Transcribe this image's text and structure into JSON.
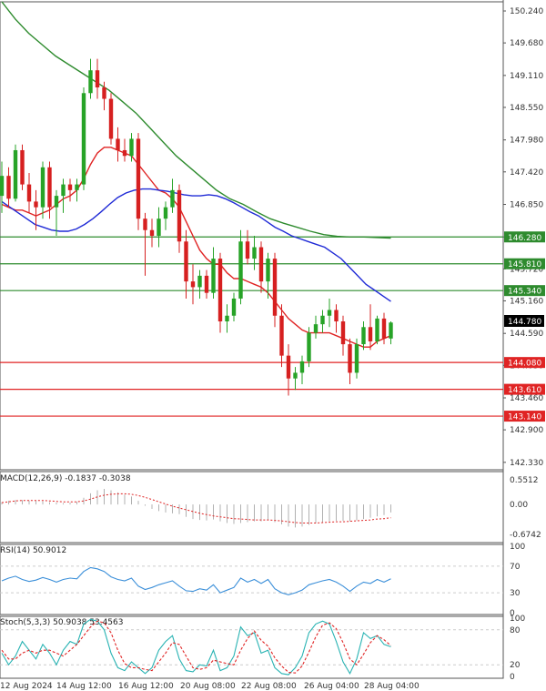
{
  "chart_data": [
    {
      "type": "candlestick",
      "title": "",
      "time_labels": [
        "12 Aug 2024",
        "14 Aug 12:00",
        "16 Aug 12:00",
        "20 Aug 08:00",
        "22 Aug 08:00",
        "26 Aug 04:00",
        "28 Aug 04:00"
      ],
      "y_ticks": [
        "150.240",
        "149.680",
        "149.110",
        "148.550",
        "147.980",
        "147.420",
        "146.850",
        "146.280",
        "145.720",
        "145.160",
        "144.590",
        "144.030",
        "143.460",
        "142.900",
        "142.330"
      ],
      "ylim": [
        142.2,
        150.4
      ],
      "current_price": "144.780",
      "horizontal_levels": [
        {
          "value": 146.28,
          "label": "146.280",
          "color": "#2e8b2e"
        },
        {
          "value": 145.81,
          "label": "145.810",
          "color": "#2e8b2e"
        },
        {
          "value": 145.34,
          "label": "145.340",
          "color": "#2e8b2e"
        },
        {
          "value": 144.08,
          "label": "144.080",
          "color": "#e02424"
        },
        {
          "value": 143.61,
          "label": "143.610",
          "color": "#e02424"
        },
        {
          "value": 143.14,
          "label": "143.140",
          "color": "#e02424"
        }
      ],
      "candles": [
        [
          147.0,
          147.6,
          146.7,
          147.35
        ],
        [
          147.35,
          147.5,
          146.8,
          146.95
        ],
        [
          146.95,
          147.9,
          146.9,
          147.8
        ],
        [
          147.8,
          147.9,
          147.1,
          147.2
        ],
        [
          147.2,
          147.4,
          146.7,
          146.9
        ],
        [
          146.9,
          147.1,
          146.4,
          146.8
        ],
        [
          146.8,
          147.6,
          146.6,
          147.5
        ],
        [
          147.5,
          147.6,
          146.6,
          146.8
        ],
        [
          146.8,
          147.1,
          146.3,
          147.0
        ],
        [
          147.0,
          147.3,
          146.7,
          147.2
        ],
        [
          147.2,
          147.3,
          146.9,
          147.1
        ],
        [
          147.1,
          147.3,
          146.9,
          147.2
        ],
        [
          147.2,
          148.9,
          147.1,
          148.8
        ],
        [
          148.8,
          149.4,
          148.7,
          149.2
        ],
        [
          149.2,
          149.4,
          148.7,
          148.9
        ],
        [
          148.9,
          149.0,
          148.5,
          148.7
        ],
        [
          148.7,
          148.8,
          147.9,
          148.0
        ],
        [
          148.0,
          148.2,
          147.6,
          147.8
        ],
        [
          147.8,
          148.0,
          147.6,
          147.7
        ],
        [
          147.7,
          148.1,
          147.6,
          148.0
        ],
        [
          148.0,
          148.1,
          146.4,
          146.6
        ],
        [
          146.6,
          146.7,
          145.6,
          146.4
        ],
        [
          146.4,
          146.6,
          146.1,
          146.3
        ],
        [
          146.3,
          146.8,
          146.1,
          146.6
        ],
        [
          146.6,
          146.9,
          146.4,
          146.8
        ],
        [
          146.8,
          147.3,
          146.7,
          147.1
        ],
        [
          147.1,
          147.2,
          146.0,
          146.2
        ],
        [
          146.2,
          146.4,
          145.2,
          145.5
        ],
        [
          145.5,
          145.8,
          145.1,
          145.4
        ],
        [
          145.4,
          145.7,
          145.2,
          145.6
        ],
        [
          145.6,
          145.7,
          145.2,
          145.3
        ],
        [
          145.3,
          146.1,
          145.2,
          145.9
        ],
        [
          145.9,
          146.0,
          144.6,
          144.8
        ],
        [
          144.8,
          145.1,
          144.6,
          144.9
        ],
        [
          144.9,
          145.3,
          144.8,
          145.2
        ],
        [
          145.2,
          146.4,
          145.1,
          146.2
        ],
        [
          146.2,
          146.4,
          145.8,
          145.9
        ],
        [
          145.9,
          146.3,
          145.7,
          146.1
        ],
        [
          146.1,
          146.2,
          145.3,
          145.5
        ],
        [
          145.5,
          146.0,
          145.2,
          145.9
        ],
        [
          145.9,
          146.0,
          144.7,
          144.9
        ],
        [
          144.9,
          145.1,
          144.0,
          144.2
        ],
        [
          144.2,
          144.4,
          143.5,
          143.8
        ],
        [
          143.8,
          144.0,
          143.6,
          143.9
        ],
        [
          143.9,
          144.2,
          143.7,
          144.1
        ],
        [
          144.1,
          144.7,
          144.0,
          144.6
        ],
        [
          144.6,
          144.9,
          144.5,
          144.75
        ],
        [
          144.75,
          145.0,
          144.6,
          144.9
        ],
        [
          144.9,
          145.2,
          144.7,
          145.0
        ],
        [
          145.0,
          145.1,
          144.6,
          144.8
        ],
        [
          144.8,
          144.9,
          144.2,
          144.4
        ],
        [
          144.4,
          144.5,
          143.7,
          143.9
        ],
        [
          143.9,
          144.5,
          143.8,
          144.4
        ],
        [
          144.4,
          144.8,
          144.3,
          144.7
        ],
        [
          144.7,
          145.1,
          144.3,
          144.45
        ],
        [
          144.45,
          144.9,
          144.4,
          144.85
        ],
        [
          144.85,
          144.95,
          144.4,
          144.5
        ],
        [
          144.5,
          144.8,
          144.4,
          144.78
        ]
      ],
      "series": [
        {
          "values": [
            146.85,
            146.8,
            146.75,
            146.75,
            146.7,
            146.65,
            146.7,
            146.75,
            146.85,
            146.95,
            147.0,
            147.1,
            147.3,
            147.55,
            147.75,
            147.85,
            147.85,
            147.8,
            147.75,
            147.7,
            147.55,
            147.4,
            147.25,
            147.1,
            147.05,
            146.95,
            146.8,
            146.55,
            146.3,
            146.05,
            145.9,
            145.8,
            145.8,
            145.65,
            145.55,
            145.55,
            145.5,
            145.45,
            145.4,
            145.3,
            145.15,
            145.0,
            144.85,
            144.75,
            144.65,
            144.6,
            144.6,
            144.6,
            144.6,
            144.55,
            144.5,
            144.45,
            144.4,
            144.35,
            144.35,
            144.45,
            144.5,
            144.55
          ],
          "color": "#e02424"
        },
        {
          "values": [
            146.9,
            146.8,
            146.7,
            146.6,
            146.5,
            146.45,
            146.4,
            146.38,
            146.38,
            146.42,
            146.5,
            146.6,
            146.72,
            146.85,
            146.97,
            147.05,
            147.1,
            147.12,
            147.12,
            147.1,
            147.08,
            147.05,
            147.02,
            147.0,
            147.0,
            147.02,
            147.0,
            146.95,
            146.88,
            146.8,
            146.72,
            146.65,
            146.55,
            146.45,
            146.38,
            146.3,
            146.25,
            146.2,
            146.15,
            146.1,
            146.0,
            145.9,
            145.75,
            145.6,
            145.45,
            145.35,
            145.25,
            145.15
          ],
          "color": "#1f2ad6"
        },
        {
          "values": [
            150.4,
            150.1,
            149.85,
            149.65,
            149.45,
            149.3,
            149.15,
            149.0,
            148.85,
            148.65,
            148.45,
            148.2,
            147.95,
            147.7,
            147.5,
            147.3,
            147.1,
            146.95,
            146.85,
            146.72,
            146.6,
            146.52,
            146.45,
            146.38,
            146.32,
            146.29,
            146.28,
            146.28,
            146.27,
            146.26
          ],
          "color": "#2e8b2e"
        }
      ]
    },
    {
      "type": "macd",
      "label": "MACD(12,26,9) -0.1837 -0.3038",
      "y_ticks": [
        "0.5512",
        "0.00",
        "-0.6742"
      ],
      "ylim": [
        -0.82,
        0.7
      ],
      "histogram": [
        0.05,
        0.08,
        0.1,
        0.1,
        0.09,
        0.08,
        0.07,
        0.05,
        0.04,
        0.03,
        0.04,
        0.06,
        0.15,
        0.25,
        0.32,
        0.35,
        0.32,
        0.27,
        0.22,
        0.18,
        0.08,
        -0.03,
        -0.1,
        -0.15,
        -0.18,
        -0.2,
        -0.22,
        -0.28,
        -0.33,
        -0.35,
        -0.36,
        -0.34,
        -0.38,
        -0.42,
        -0.44,
        -0.42,
        -0.4,
        -0.38,
        -0.38,
        -0.36,
        -0.4,
        -0.45,
        -0.5,
        -0.52,
        -0.5,
        -0.46,
        -0.42,
        -0.4,
        -0.38,
        -0.37,
        -0.37,
        -0.38,
        -0.36,
        -0.33,
        -0.3,
        -0.27,
        -0.24,
        -0.18
      ],
      "signal": [
        0.04,
        0.06,
        0.08,
        0.09,
        0.09,
        0.09,
        0.09,
        0.08,
        0.07,
        0.06,
        0.06,
        0.06,
        0.08,
        0.12,
        0.17,
        0.21,
        0.23,
        0.24,
        0.24,
        0.23,
        0.2,
        0.16,
        0.11,
        0.06,
        0.01,
        -0.04,
        -0.08,
        -0.12,
        -0.16,
        -0.2,
        -0.23,
        -0.26,
        -0.28,
        -0.3,
        -0.32,
        -0.33,
        -0.34,
        -0.35,
        -0.35,
        -0.35,
        -0.36,
        -0.37,
        -0.39,
        -0.41,
        -0.42,
        -0.42,
        -0.42,
        -0.41,
        -0.4,
        -0.39,
        -0.39,
        -0.38,
        -0.37,
        -0.36,
        -0.35,
        -0.33,
        -0.32,
        -0.3
      ],
      "histogram_color": "#b0b0b0",
      "signal_color": "#e02424"
    },
    {
      "type": "line",
      "label": "RSI(14) 50.9012",
      "y_ticks": [
        "100",
        "70",
        "30",
        "0"
      ],
      "ylim": [
        0,
        100
      ],
      "series": [
        {
          "values": [
            48,
            52,
            55,
            50,
            47,
            49,
            53,
            50,
            46,
            50,
            52,
            51,
            62,
            68,
            66,
            62,
            54,
            50,
            48,
            52,
            40,
            35,
            38,
            42,
            45,
            48,
            40,
            33,
            32,
            36,
            34,
            42,
            30,
            34,
            38,
            52,
            46,
            50,
            44,
            50,
            36,
            30,
            27,
            30,
            34,
            42,
            45,
            48,
            50,
            46,
            40,
            32,
            40,
            46,
            44,
            50,
            46,
            51
          ],
          "color": "#3b8fd9"
        }
      ],
      "levels": [
        70,
        30
      ]
    },
    {
      "type": "line",
      "label": "Stoch(5,3,3) 50.9038 53.4563",
      "y_ticks": [
        "100",
        "80",
        "20",
        "0"
      ],
      "ylim": [
        0,
        100
      ],
      "series": [
        {
          "values": [
            40,
            20,
            35,
            60,
            45,
            30,
            55,
            40,
            20,
            45,
            60,
            55,
            90,
            98,
            95,
            80,
            40,
            15,
            10,
            25,
            15,
            5,
            15,
            45,
            60,
            70,
            30,
            10,
            8,
            20,
            18,
            45,
            10,
            15,
            35,
            85,
            70,
            75,
            40,
            45,
            15,
            5,
            3,
            15,
            35,
            75,
            90,
            95,
            90,
            60,
            25,
            5,
            30,
            75,
            65,
            70,
            55,
            51
          ],
          "color": "#29b3b3"
        },
        {
          "values": [
            45,
            30,
            30,
            40,
            45,
            40,
            45,
            45,
            40,
            35,
            45,
            55,
            70,
            85,
            95,
            92,
            75,
            45,
            22,
            15,
            15,
            12,
            10,
            25,
            40,
            58,
            55,
            35,
            15,
            12,
            15,
            28,
            25,
            22,
            20,
            45,
            65,
            78,
            62,
            52,
            32,
            18,
            7,
            6,
            18,
            42,
            68,
            88,
            92,
            82,
            58,
            30,
            20,
            38,
            58,
            70,
            63,
            53
          ],
          "color": "#e02424"
        }
      ],
      "levels": [
        80,
        20
      ]
    }
  ]
}
